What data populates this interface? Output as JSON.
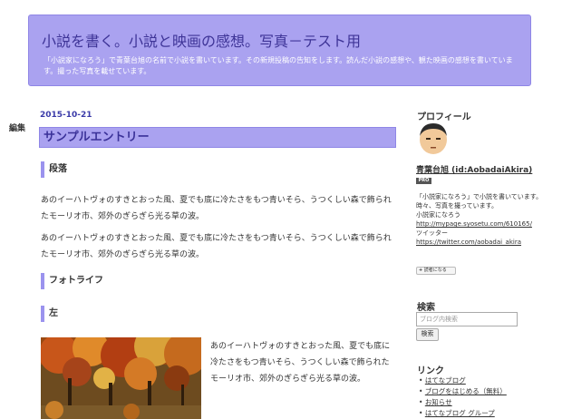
{
  "header": {
    "title": "小説を書く。小説と映画の感想。写真－テスト用",
    "description": "「小説家になろう」で青葉台旭の名前で小説を書いています。その新規投稿の告知をします。読んだ小説の感想や、観た映画の感想を書いています。撮った写真を載せています。"
  },
  "edit_label": "編集",
  "entry": {
    "date": "2015-10-21",
    "title": "サンプルエントリー",
    "section1": "段落",
    "para1": "あのイーハトヴォのすきとおった風、夏でも底に冷たさをもつ青いそら、うつくしい森で飾られたモーリオ市、郊外のぎらぎら光る草の波。",
    "para2": "あのイーハトヴォのすきとおった風、夏でも底に冷たさをもつ青いそら、うつくしい森で飾られたモーリオ市、郊外のぎらぎら光る草の波。",
    "section2": "フォトライフ",
    "section3": "左",
    "photo_text": "あのイーハトヴォのすきとおった風、夏でも底に冷たさをもつ青いそら、うつくしい森で飾られたモーリオ市、郊外のぎらぎら光る草の波。"
  },
  "sidebar": {
    "profile_heading": "プロフィール",
    "user_name": "青葉台旭 (id:AobadaiAkira)",
    "pro_badge": "PRO",
    "profile_line1": "「小説家になろう」で小説を書いています。",
    "profile_line2": "時々、写真を撮っています。",
    "profile_line3": "小説家になろう",
    "profile_url1": "http://mypage.syosetu.com/610165/",
    "profile_line4": "ツイッター",
    "profile_url2": "https://twitter.com/aobadai_akira",
    "reader_plus": "+",
    "reader_label": "読者になる",
    "search_heading": "検索",
    "search_placeholder": "ブログ内検索",
    "search_button": "検索",
    "links_heading": "リンク",
    "links": [
      "はてなブログ",
      "ブログをはじめる（無料）",
      "お知らせ",
      "はてなブログ グループ"
    ]
  },
  "colors": {
    "header_bg": "#aaa2f0",
    "title_text": "#3e3497",
    "accent_border": "#9b93ee",
    "date_text": "#3a3aa8"
  }
}
